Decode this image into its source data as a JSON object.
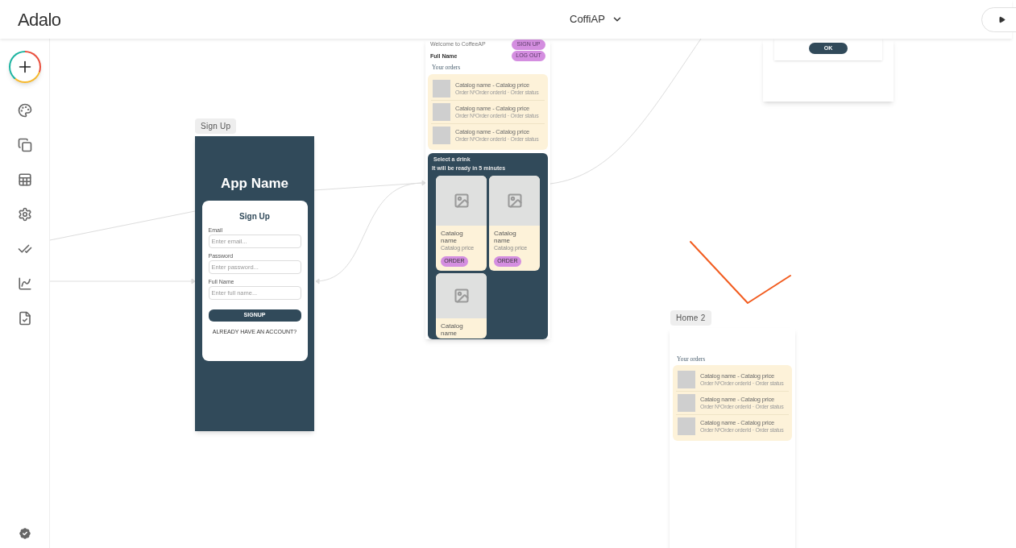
{
  "header": {
    "logo": "Adalo",
    "project": "CoffiAP"
  },
  "screens": [
    {
      "kind": "signup",
      "label": "Sign Up",
      "app_name": "App Name",
      "form_title": "Sign Up",
      "fields": [
        {
          "label": "Email",
          "placeholder": "Enter email..."
        },
        {
          "label": "Password",
          "placeholder": "Enter password..."
        },
        {
          "label": "Full Name",
          "placeholder": "Enter full name..."
        }
      ],
      "submit": "SIGNUP",
      "link": "ALREADY HAVE AN ACCOUNT?"
    },
    {
      "kind": "home",
      "welcome": "Welcome to CoffeeAP",
      "user_name": "Full Name",
      "buttons": [
        "SIGN UP",
        "LOG OUT"
      ],
      "orders_title": "Your orders",
      "orders": [
        {
          "title": "Catalog name - Catalog price",
          "subtitle": "Order NºOrder orderId · Order status"
        },
        {
          "title": "Catalog name - Catalog price",
          "subtitle": "Order NºOrder orderId · Order status"
        },
        {
          "title": "Catalog name - Catalog price",
          "subtitle": "Order NºOrder orderId · Order status"
        }
      ],
      "catalog": {
        "heading": "Select a drink",
        "subheading": "It will be ready in 5 minutes",
        "items": [
          {
            "name": "Catalog name",
            "price": "Catalog price",
            "button": "ORDER"
          },
          {
            "name": "Catalog name",
            "price": "Catalog price",
            "button": "ORDER"
          },
          {
            "name": "Catalog name"
          }
        ]
      }
    },
    {
      "kind": "dialog",
      "button": "OK"
    },
    {
      "kind": "home2",
      "label": "Home 2",
      "orders_title": "Your orders",
      "orders": [
        {
          "title": "Catalog name - Catalog price",
          "subtitle": "Order NºOrder orderId · Order status"
        },
        {
          "title": "Catalog name - Catalog price",
          "subtitle": "Order NºOrder orderId · Order status"
        },
        {
          "title": "Catalog name - Catalog price",
          "subtitle": "Order NºOrder orderId · Order status"
        }
      ]
    }
  ]
}
